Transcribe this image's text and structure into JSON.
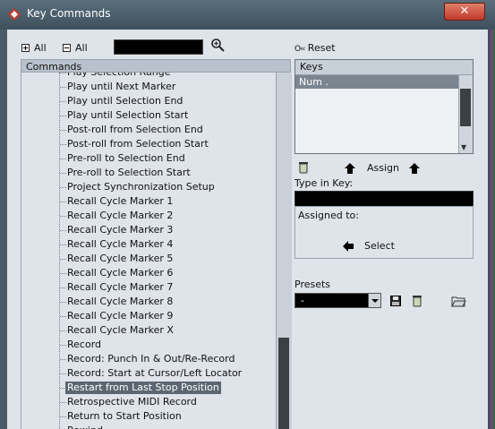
{
  "window": {
    "title": "Key Commands",
    "close_label": "✕"
  },
  "toolbar": {
    "expand_all_label": "All",
    "collapse_all_label": "All",
    "search_value": ""
  },
  "commands": {
    "header": "Commands",
    "items": [
      "Play Selection Range",
      "Play until Next Marker",
      "Play until Selection End",
      "Play until Selection Start",
      "Post-roll from Selection End",
      "Post-roll from Selection Start",
      "Pre-roll to Selection End",
      "Pre-roll to Selection Start",
      "Project Synchronization Setup",
      "Recall Cycle Marker 1",
      "Recall Cycle Marker 2",
      "Recall Cycle Marker 3",
      "Recall Cycle Marker 4",
      "Recall Cycle Marker 5",
      "Recall Cycle Marker 6",
      "Recall Cycle Marker 7",
      "Recall Cycle Marker 8",
      "Recall Cycle Marker 9",
      "Recall Cycle Marker X",
      "Record",
      "Record: Punch In & Out/Re-Record",
      "Record: Start at Cursor/Left Locator",
      "Restart from Last Stop Position",
      "Retrospective MIDI Record",
      "Return to Start Position",
      "Rewind"
    ],
    "selected_index": 22
  },
  "right": {
    "reset_icon": "O‹‹",
    "reset_label": "Reset",
    "keys_header": "Keys",
    "keys": [
      "Num ."
    ],
    "assign_label": "Assign",
    "type_in_key_label": "Type in Key:",
    "type_in_key_value": "",
    "assigned_to_label": "Assigned to:",
    "select_label": "Select",
    "presets_label": "Presets",
    "presets_value": "-"
  },
  "colors": {
    "selection": "#5c6670",
    "panel": "#dfe4ea",
    "titlebar": "#4a5d6a"
  }
}
